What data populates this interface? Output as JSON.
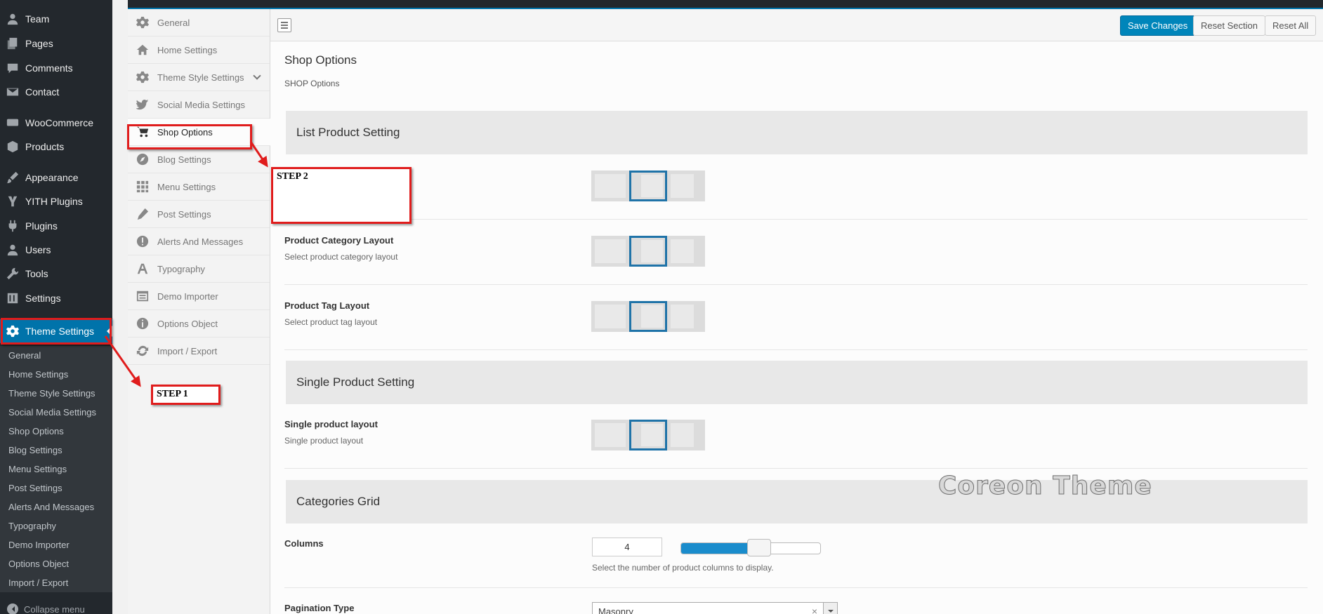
{
  "wp_menu": {
    "items": [
      {
        "label": "Team",
        "icon": "user-icon"
      },
      {
        "label": "Pages",
        "icon": "pages-icon"
      },
      {
        "label": "Comments",
        "icon": "comment-icon"
      },
      {
        "label": "Contact",
        "icon": "mail-icon"
      },
      {
        "label": "WooCommerce",
        "icon": "woo-icon"
      },
      {
        "label": "Products",
        "icon": "box-icon"
      },
      {
        "label": "Appearance",
        "icon": "brush-icon"
      },
      {
        "label": "YITH Plugins",
        "icon": "yith-icon"
      },
      {
        "label": "Plugins",
        "icon": "plug-icon"
      },
      {
        "label": "Users",
        "icon": "user-icon"
      },
      {
        "label": "Tools",
        "icon": "wrench-icon"
      },
      {
        "label": "Settings",
        "icon": "sliders-icon"
      }
    ],
    "current": {
      "label": "Theme Settings",
      "icon": "gear-icon"
    },
    "submenu": [
      "General",
      "Home Settings",
      "Theme Style Settings",
      "Social Media Settings",
      "Shop Options",
      "Blog Settings",
      "Menu Settings",
      "Post Settings",
      "Alerts And Messages",
      "Typography",
      "Demo Importer",
      "Options Object",
      "Import / Export"
    ],
    "collapse_label": "Collapse menu"
  },
  "options_sidebar": {
    "items": [
      {
        "label": "General",
        "icon": "gear-icon"
      },
      {
        "label": "Home Settings",
        "icon": "home-icon"
      },
      {
        "label": "Theme Style Settings",
        "icon": "gear-icon"
      },
      {
        "label": "Social Media Settings",
        "icon": "twitter-icon"
      },
      {
        "label": "Shop Options",
        "icon": "cart-icon"
      },
      {
        "label": "Blog Settings",
        "icon": "compass-icon"
      },
      {
        "label": "Menu Settings",
        "icon": "grid-icon"
      },
      {
        "label": "Post Settings",
        "icon": "pencil-icon"
      },
      {
        "label": "Alerts And Messages",
        "icon": "alert-icon"
      },
      {
        "label": "Typography",
        "icon": "font-icon"
      },
      {
        "label": "Demo Importer",
        "icon": "window-icon"
      },
      {
        "label": "Options Object",
        "icon": "info-icon"
      },
      {
        "label": "Import / Export",
        "icon": "refresh-icon"
      }
    ],
    "active": "Shop Options"
  },
  "toolbar": {
    "save_label": "Save Changes",
    "reset_section_label": "Reset Section",
    "reset_all_label": "Reset All"
  },
  "content": {
    "title": "Shop Options",
    "subtitle": "SHOP Options",
    "list_product_heading": "List Product Setting",
    "category_layout": {
      "title": "Product Category Layout",
      "desc": "Select product category layout"
    },
    "tag_layout": {
      "title": "Product Tag Layout",
      "desc": "Select product tag layout"
    },
    "single_heading": "Single Product Setting",
    "single_layout": {
      "title": "Single product layout",
      "desc": "Single product layout"
    },
    "categories_heading": "Categories Grid",
    "columns": {
      "title": "Columns",
      "value": "4",
      "desc": "Select the number of product columns to display.",
      "slider_fraction": 0.56
    },
    "pagination": {
      "title": "Pagination Type",
      "value": "Masonry"
    },
    "layout_selected_index": 1
  },
  "watermark": "Coreon Theme",
  "annotations": {
    "step1": "STEP 1",
    "step2": "STEP 2",
    "color": "#e01c1c"
  },
  "colors": {
    "wp_sidebar": "#23282d",
    "accent": "#0073aa",
    "primary_button": "#0085ba"
  }
}
